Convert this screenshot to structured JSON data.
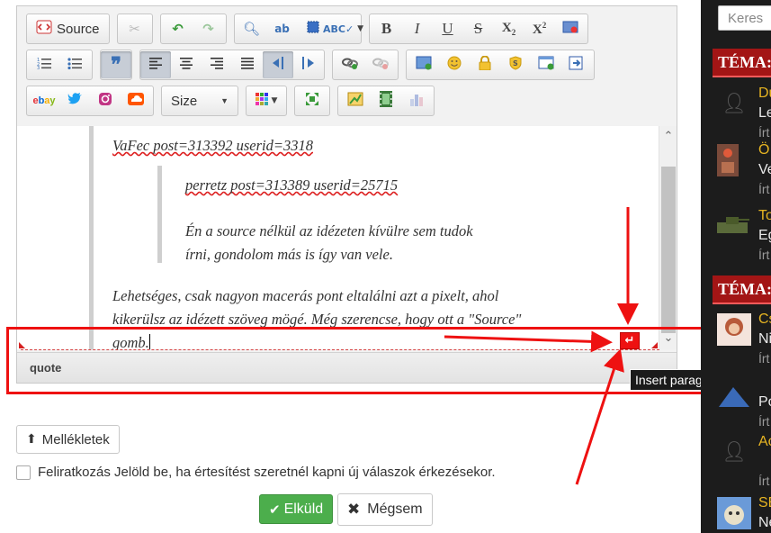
{
  "toolbar": {
    "source_label": "Source",
    "size_label": "Size"
  },
  "content": {
    "line1": "VaFec post=313392 userid=3318",
    "line2": "perretz post=313389 userid=25715",
    "line3": "Én a source nélkül az idézeten kívülre sem tudok",
    "line4": "írni, gondolom más is így van vele.",
    "line5": "Lehetséges, csak nagyon macerás pont eltalálni azt a pixelt, ahol",
    "line6": "kikerülsz az idézett szöveg mögé. Még szerencse, hogy ott a \"Source\"",
    "line7": "gomb."
  },
  "statusbar": {
    "path": "quote"
  },
  "tooltip": "Insert paragraph here",
  "attachments_label": "Mellékletek",
  "subscribe": {
    "label": "Feliratkozás",
    "hint": "Jelöld be, ha értesítést szeretnél kapni új válaszok érkezésekor."
  },
  "submit_label": "Elküld",
  "cancel_label": "Mégsem",
  "sidebar": {
    "search_placeholder": "Keres",
    "header1": "TÉMA: O",
    "header2": "TÉMA: M",
    "items": [
      {
        "t1": "Du",
        "t2": "Le",
        "t3": "Írt"
      },
      {
        "t1": "Ö",
        "t2": "Ve",
        "t3": "Írt"
      },
      {
        "t1": "To",
        "t2": "Eg",
        "t3": "Írt"
      },
      {
        "t1": "Cs",
        "t2": "Ni",
        "t3": "Írt"
      },
      {
        "t1": "",
        "t2": "Po",
        "t3": "Írt"
      },
      {
        "t1": "Ac",
        "t2": "",
        "t3": "Írt"
      },
      {
        "t1": "SE",
        "t2": "Ne",
        "t3": ""
      }
    ]
  },
  "colors": {
    "annotation_red": "#ee1111",
    "submit_green": "#4cae4c",
    "sidebar_header": "#a31515",
    "sidebar_title_gold": "#e6b422"
  }
}
